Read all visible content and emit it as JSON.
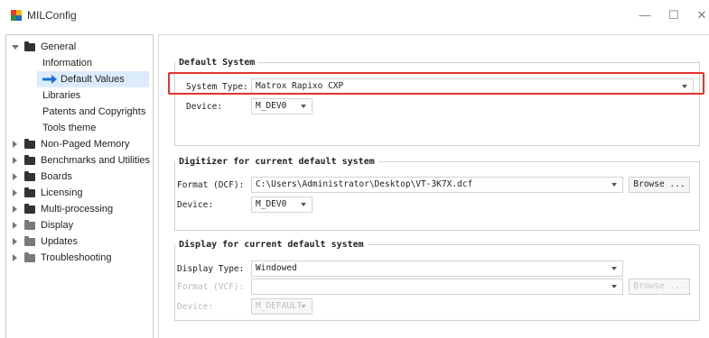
{
  "window": {
    "title": "MILConfig",
    "minimize_symbol": "—",
    "maximize_symbol": "☐",
    "close_symbol": "✕"
  },
  "sidebar": {
    "items": [
      {
        "label": "General"
      },
      {
        "label": "Information"
      },
      {
        "label": "Default Values",
        "icon": "arrow-right-icon"
      },
      {
        "label": "Libraries"
      },
      {
        "label": "Patents and Copyrights"
      },
      {
        "label": "Tools theme"
      },
      {
        "label": "Non-Paged Memory"
      },
      {
        "label": "Benchmarks and Utilities"
      },
      {
        "label": "Boards"
      },
      {
        "label": "Licensing"
      },
      {
        "label": "Multi-processing"
      },
      {
        "label": "Display"
      },
      {
        "label": "Updates"
      },
      {
        "label": "Troubleshooting"
      }
    ]
  },
  "default_system": {
    "legend": "Default System",
    "system_type_label": "System Type:",
    "system_type_value": "Matrox Rapixo CXP",
    "device_label": "Device:",
    "device_value": "M_DEV0"
  },
  "digitizer": {
    "legend": "Digitizer for current default system",
    "format_label": "Format (DCF):",
    "format_value": "C:\\Users\\Administrator\\Desktop\\VT-3K7X.dcf",
    "browse_label": "Browse ...",
    "device_label": "Device:",
    "device_value": "M_DEV0"
  },
  "display": {
    "legend": "Display for current default system",
    "display_type_label": "Display Type:",
    "display_type_value": "Windowed",
    "format_label": "Format (VCF):",
    "format_value": "",
    "browse_label": "Browse ...",
    "device_label": "Device:",
    "device_value": "M_DEFAULT"
  },
  "colors": {
    "highlight_border": "#e8322d",
    "selection_background": "#dcebfb",
    "arrow_blue": "#1e6fd9"
  }
}
